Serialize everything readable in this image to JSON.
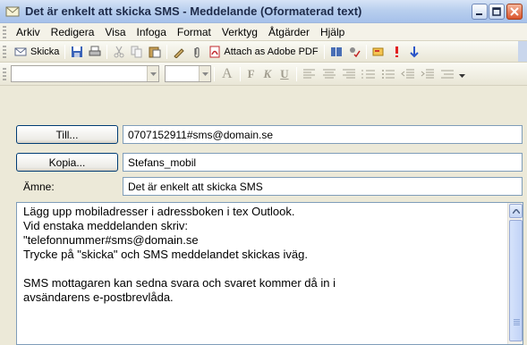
{
  "window": {
    "title": "Det är enkelt att skicka SMS - Meddelande (Oformaterad text)"
  },
  "menubar": {
    "items": [
      "Arkiv",
      "Redigera",
      "Visa",
      "Infoga",
      "Format",
      "Verktyg",
      "Åtgärder",
      "Hjälp"
    ]
  },
  "toolbar": {
    "send_label": "Skicka",
    "attach_pdf_label": "Attach as Adobe PDF"
  },
  "format_toolbar": {
    "font_value": "",
    "size_value": "",
    "glyph_a": "A",
    "glyph_bold": "F",
    "glyph_italic": "K",
    "glyph_underline": "U"
  },
  "header": {
    "to_button": "Till...",
    "to_value": "0707152911#sms@domain.se",
    "cc_button": "Kopia...",
    "cc_value": "Stefans_mobil",
    "subject_label": "Ämne:",
    "subject_value": "Det är enkelt att skicka SMS"
  },
  "body": {
    "lines": [
      "Lägg upp mobiladresser i adressboken i tex Outlook.",
      "Vid enstaka meddelanden skriv:",
      "\"telefonnummer#sms@domain.se",
      "Trycke på \"skicka\" och SMS meddelandet skickas iväg.",
      "",
      "SMS mottagaren kan sedna svara och svaret kommer då in i",
      "avsändarens e-postbrevlåda."
    ]
  },
  "colors": {
    "title_bar": "#B9CFEE",
    "close_button": "#D9542C",
    "field_border": "#7F9DB9",
    "button_border": "#003C74"
  },
  "icons": [
    "envelope-icon",
    "minimize-icon",
    "maximize-icon",
    "close-icon",
    "save-icon",
    "print-icon",
    "cut-icon",
    "copy-icon",
    "paste-icon",
    "pen-icon",
    "paperclip-icon",
    "pdf-icon",
    "address-book-icon",
    "check-names-icon",
    "options-icon",
    "importance-high-icon",
    "importance-low-icon"
  ]
}
